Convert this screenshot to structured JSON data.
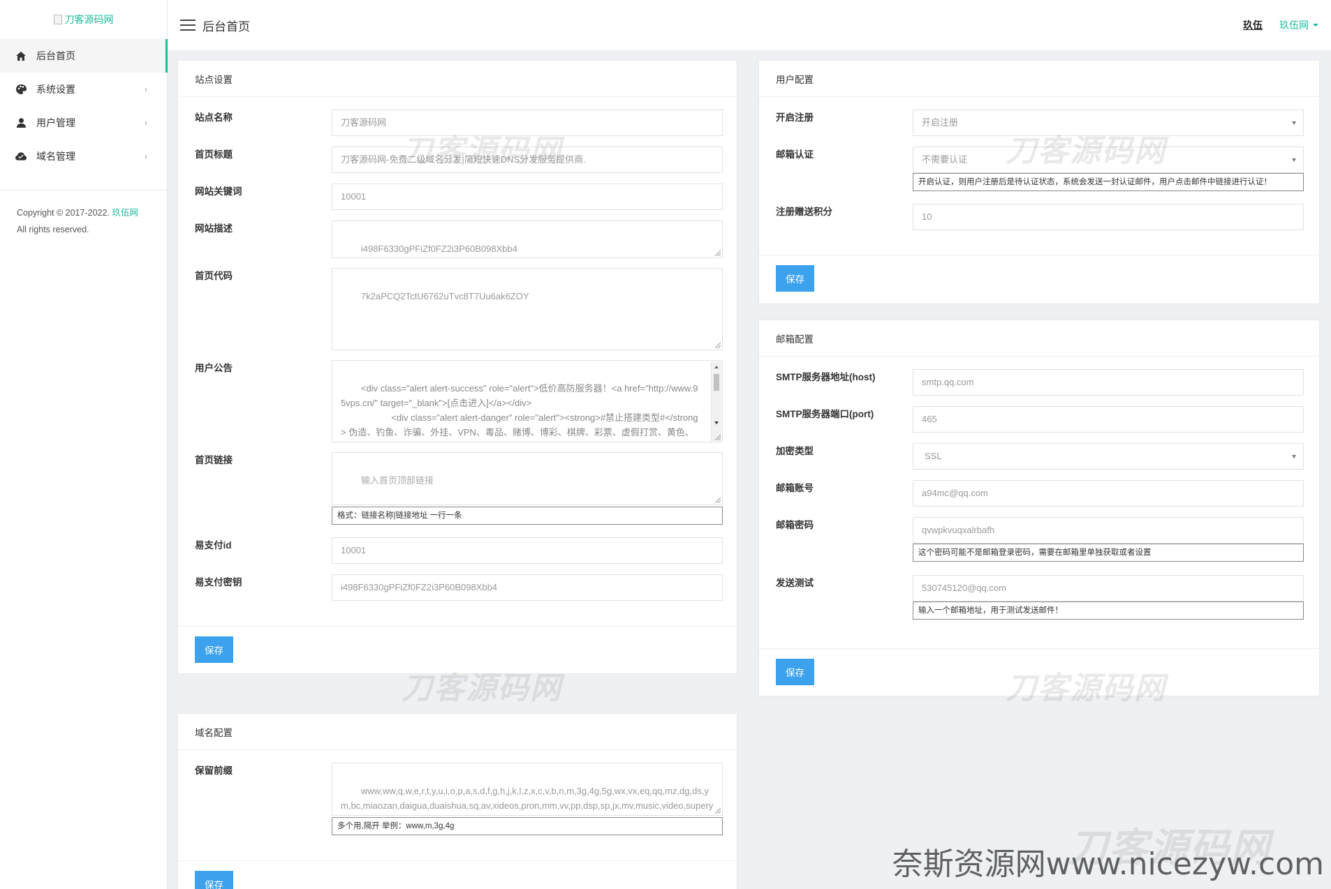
{
  "sidebar": {
    "logo_alt": "刀客源码网",
    "items": [
      {
        "label": "后台首页",
        "icon": "home-icon",
        "active": true
      },
      {
        "label": "系统设置",
        "icon": "palette-icon",
        "arrow": "›"
      },
      {
        "label": "用户管理",
        "icon": "user-icon",
        "arrow": "›"
      },
      {
        "label": "域名管理",
        "icon": "cloud-icon",
        "arrow": "›"
      }
    ],
    "copyright_prefix": "Copyright © 2017-2022.",
    "copyright_link": "玖伍网",
    "copyright_suffix": "All rights reserved."
  },
  "header": {
    "title": "后台首页",
    "user_name": "玖伍",
    "user_menu": "玖伍网"
  },
  "site_settings": {
    "heading": "站点设置",
    "fields": {
      "site_name": {
        "label": "站点名称",
        "value": "刀客源码网"
      },
      "home_title": {
        "label": "首页标题",
        "value": "刀客源码网-免费二级域名分发|简短快速DNS分发服务提供商."
      },
      "keywords": {
        "label": "网站关键词",
        "value": "10001"
      },
      "description": {
        "label": "网站描述",
        "value": "i498F6330gPFiZf0FZ2i3P60B098Xbb4"
      },
      "home_code": {
        "label": "首页代码",
        "value": "7k2aPCQ2TctU6762uTvc8T7Uu6ak6ZOY"
      },
      "notice": {
        "label": "用户公告",
        "value": "<div class=\"alert alert-success\" role=\"alert\">低价高防服务器！<a href=\"http://www.95vps.cn/\" target=\"_blank\">[点击进入]</a></div>\n                    <div class=\"alert alert-danger\" role=\"alert\"><strong>#禁止搭建类型#</strong> 伪造、钓鱼、诈骗、外挂、VPN、毒品、赌博、博彩、棋牌、彩票、虚假打赏、黄色、贷款、色情交友、盗版影视、不正常言论、不合法的信息收集、圈"
      },
      "home_links": {
        "label": "首页链接",
        "placeholder": "输入首页顶部链接",
        "help": "格式：链接名称|链接地址 一行一条"
      },
      "epay_id": {
        "label": "易支付id",
        "value": "10001"
      },
      "epay_key": {
        "label": "易支付密钥",
        "value": "i498F6330gPFiZf0FZ2i3P60B098Xbb4"
      }
    },
    "save_label": "保存"
  },
  "domain_config": {
    "heading": "域名配置",
    "reserved": {
      "label": "保留前缀",
      "value": "www,ww,q,w,e,r,t,y,u,i,o,p,a,s,d,f,g,h,j,k,l,z,x,c,v,b,n,m,3g,4g,5g,wx,vx,eq,qq,mz,dg,ds,ym,bc,miaozan,daigua,duaishua,sq,av,xideos,pron,mm,vv,pp,dsp,sp,jx,mv,music,video,superyjbry,vvv,hs,idc,cloud,vpn,fq,fh,url,dwz",
      "help": "多个用,隔开 举例：www,m,3g,4g"
    },
    "save_label": "保存"
  },
  "user_config": {
    "heading": "用户配置",
    "open_register": {
      "label": "开启注册",
      "value": "开启注册"
    },
    "email_verify": {
      "label": "邮箱认证",
      "value": "不需要认证",
      "help": "开启认证，则用户注册后是待认证状态，系统会发送一封认证邮件，用户点击邮件中链接进行认证！"
    },
    "register_points": {
      "label": "注册赠送积分",
      "value": "10"
    },
    "save_label": "保存"
  },
  "mail_config": {
    "heading": "邮箱配置",
    "smtp_host": {
      "label": "SMTP服务器地址(host)",
      "value": "smtp.qq.com"
    },
    "smtp_port": {
      "label": "SMTP服务器端口(port)",
      "value": "465"
    },
    "encryption": {
      "label": "加密类型",
      "value": "SSL"
    },
    "account": {
      "label": "邮箱账号",
      "value": "a94mc@qq.com"
    },
    "password": {
      "label": "邮箱密码",
      "value": "qvwpkvuqxalrbafh",
      "help": "这个密码可能不是邮箱登录密码，需要在邮箱里单独获取或者设置"
    },
    "send_test": {
      "label": "发送测试",
      "value": "530745120@qq.com",
      "help": "输入一个邮箱地址，用于测试发送邮件！"
    },
    "save_label": "保存"
  },
  "watermarks": {
    "brand": "刀客源码网",
    "site": "奈斯资源网www.nicezyw.com"
  }
}
